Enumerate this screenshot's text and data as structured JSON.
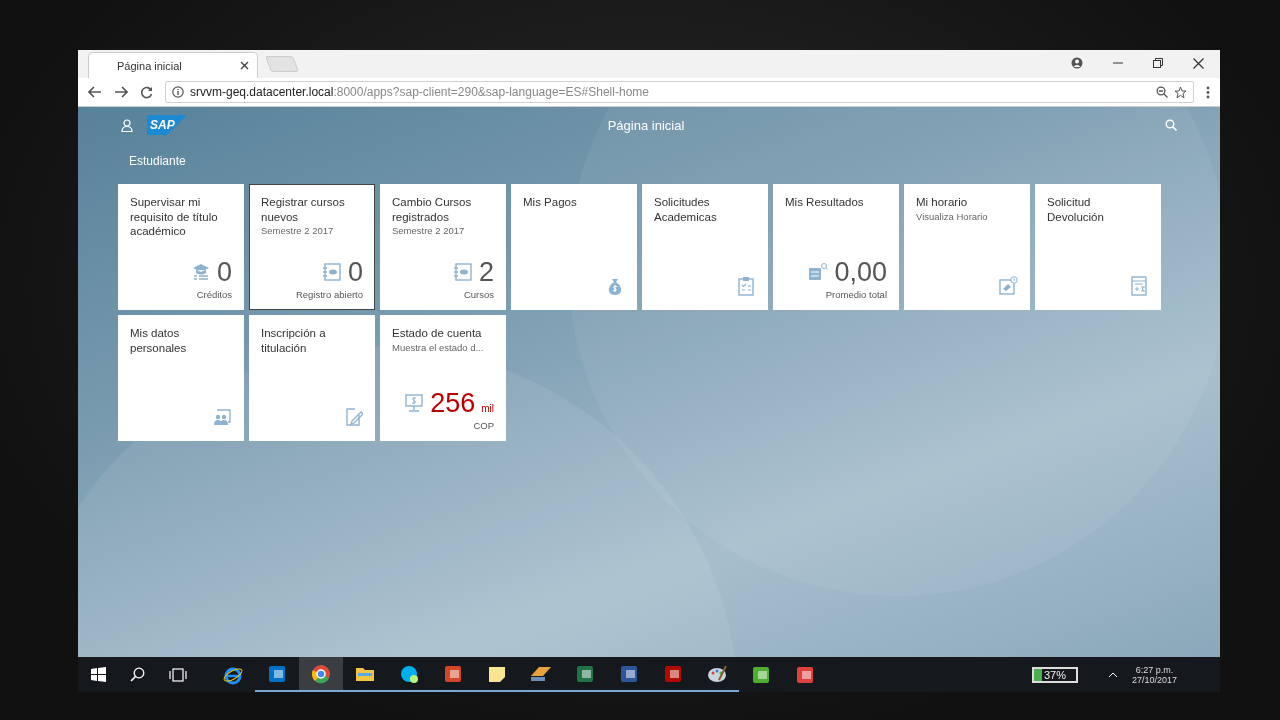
{
  "browser": {
    "tab_title": "Página inicial",
    "url_host": "srvvm-geq.datacenter.local",
    "url_rest": ":8000/apps?sap-client=290&sap-language=ES#Shell-home"
  },
  "shell": {
    "logo": "SAP",
    "title": "Página inicial"
  },
  "group": {
    "title": "Estudiante",
    "tiles": [
      {
        "kind": "grad-cap",
        "title": "Supervisar mi requisito de título académico",
        "number": "0",
        "footer": "Créditos",
        "negative": false,
        "focused": false
      },
      {
        "kind": "notebook",
        "title": "Registrar cursos nuevos",
        "subtitle": "Semestre 2 2017",
        "number": "0",
        "footer": "Registro abierto",
        "negative": false,
        "focused": true
      },
      {
        "kind": "notebook",
        "title": "Cambio Cursos registrados",
        "subtitle": "Semestre 2 2017",
        "number": "2",
        "footer": "Cursos",
        "negative": false,
        "focused": false
      },
      {
        "kind": "money-bag",
        "title": "Mis Pagos",
        "focused": false
      },
      {
        "kind": "clipboard",
        "title": "Solicitudes Academicas",
        "focused": false
      },
      {
        "kind": "chart-search",
        "title": "Mis Resultados",
        "number": "0,00",
        "footer": "Promedio total",
        "negative": false,
        "focused": false
      },
      {
        "kind": "clock-doc",
        "title": "Mi horario",
        "subtitle": "Visualiza Horario",
        "focused": false
      },
      {
        "kind": "invoice",
        "title": "Solicitud Devolución",
        "focused": false
      },
      {
        "kind": "people-board",
        "title": "Mis datos personales",
        "focused": false
      },
      {
        "kind": "pen-doc",
        "title": "Inscripción a titulación",
        "focused": false
      },
      {
        "kind": "monitor-dollar",
        "title": "Estado de cuenta",
        "subtitle": "Muestra el estado d...",
        "number": "256",
        "unit": "mil",
        "footer": "COP",
        "negative": true,
        "focused": false
      }
    ]
  },
  "taskbar": {
    "apps": [
      {
        "kind": "ie",
        "running": false,
        "selected": false
      },
      {
        "kind": "outlook",
        "running": true,
        "selected": false
      },
      {
        "kind": "chrome",
        "running": true,
        "selected": true
      },
      {
        "kind": "folder",
        "running": true,
        "selected": false
      },
      {
        "kind": "skype",
        "running": true,
        "selected": false
      },
      {
        "kind": "powerpoint",
        "running": true,
        "selected": false
      },
      {
        "kind": "notes",
        "running": true,
        "selected": false
      },
      {
        "kind": "editor",
        "running": true,
        "selected": false
      },
      {
        "kind": "excel",
        "running": true,
        "selected": false
      },
      {
        "kind": "word",
        "running": true,
        "selected": false
      },
      {
        "kind": "acrobat",
        "running": true,
        "selected": false
      },
      {
        "kind": "paint",
        "running": true,
        "selected": false
      },
      {
        "kind": "camtasia",
        "running": false,
        "selected": false
      },
      {
        "kind": "recorder",
        "running": false,
        "selected": false
      }
    ],
    "battery": "37%",
    "time": "6:27 p.m.",
    "date": "27/10/2017"
  }
}
